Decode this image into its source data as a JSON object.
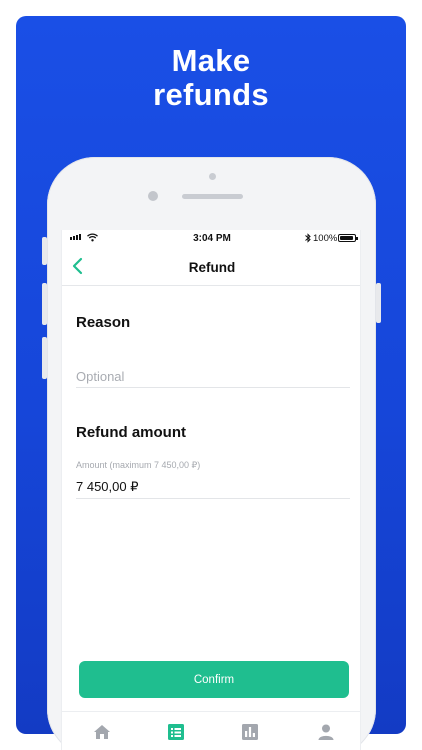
{
  "promo": {
    "headline_line1": "Make",
    "headline_line2": "refunds",
    "background_color": "#1a4fe6"
  },
  "status_bar": {
    "time": "3:04 PM",
    "battery": "100%",
    "icons": [
      "signal-icon",
      "wifi-icon",
      "bluetooth-icon",
      "battery-icon"
    ]
  },
  "nav": {
    "title": "Refund",
    "back_icon": "chevron-left-icon",
    "accent_color": "#1fbe8f"
  },
  "reason": {
    "title": "Reason",
    "placeholder": "Optional",
    "value": ""
  },
  "refund_amount": {
    "title": "Refund amount",
    "label": "Amount (maximum  7 450,00 ₽)",
    "value": "7 450,00 ₽"
  },
  "confirm": {
    "label": "Confirm",
    "color": "#1fbe8f"
  },
  "tabbar": {
    "items": [
      {
        "icon": "home-icon",
        "active": false
      },
      {
        "icon": "list-icon",
        "active": true
      },
      {
        "icon": "bar-chart-icon",
        "active": false
      },
      {
        "icon": "profile-icon",
        "active": false
      }
    ]
  }
}
